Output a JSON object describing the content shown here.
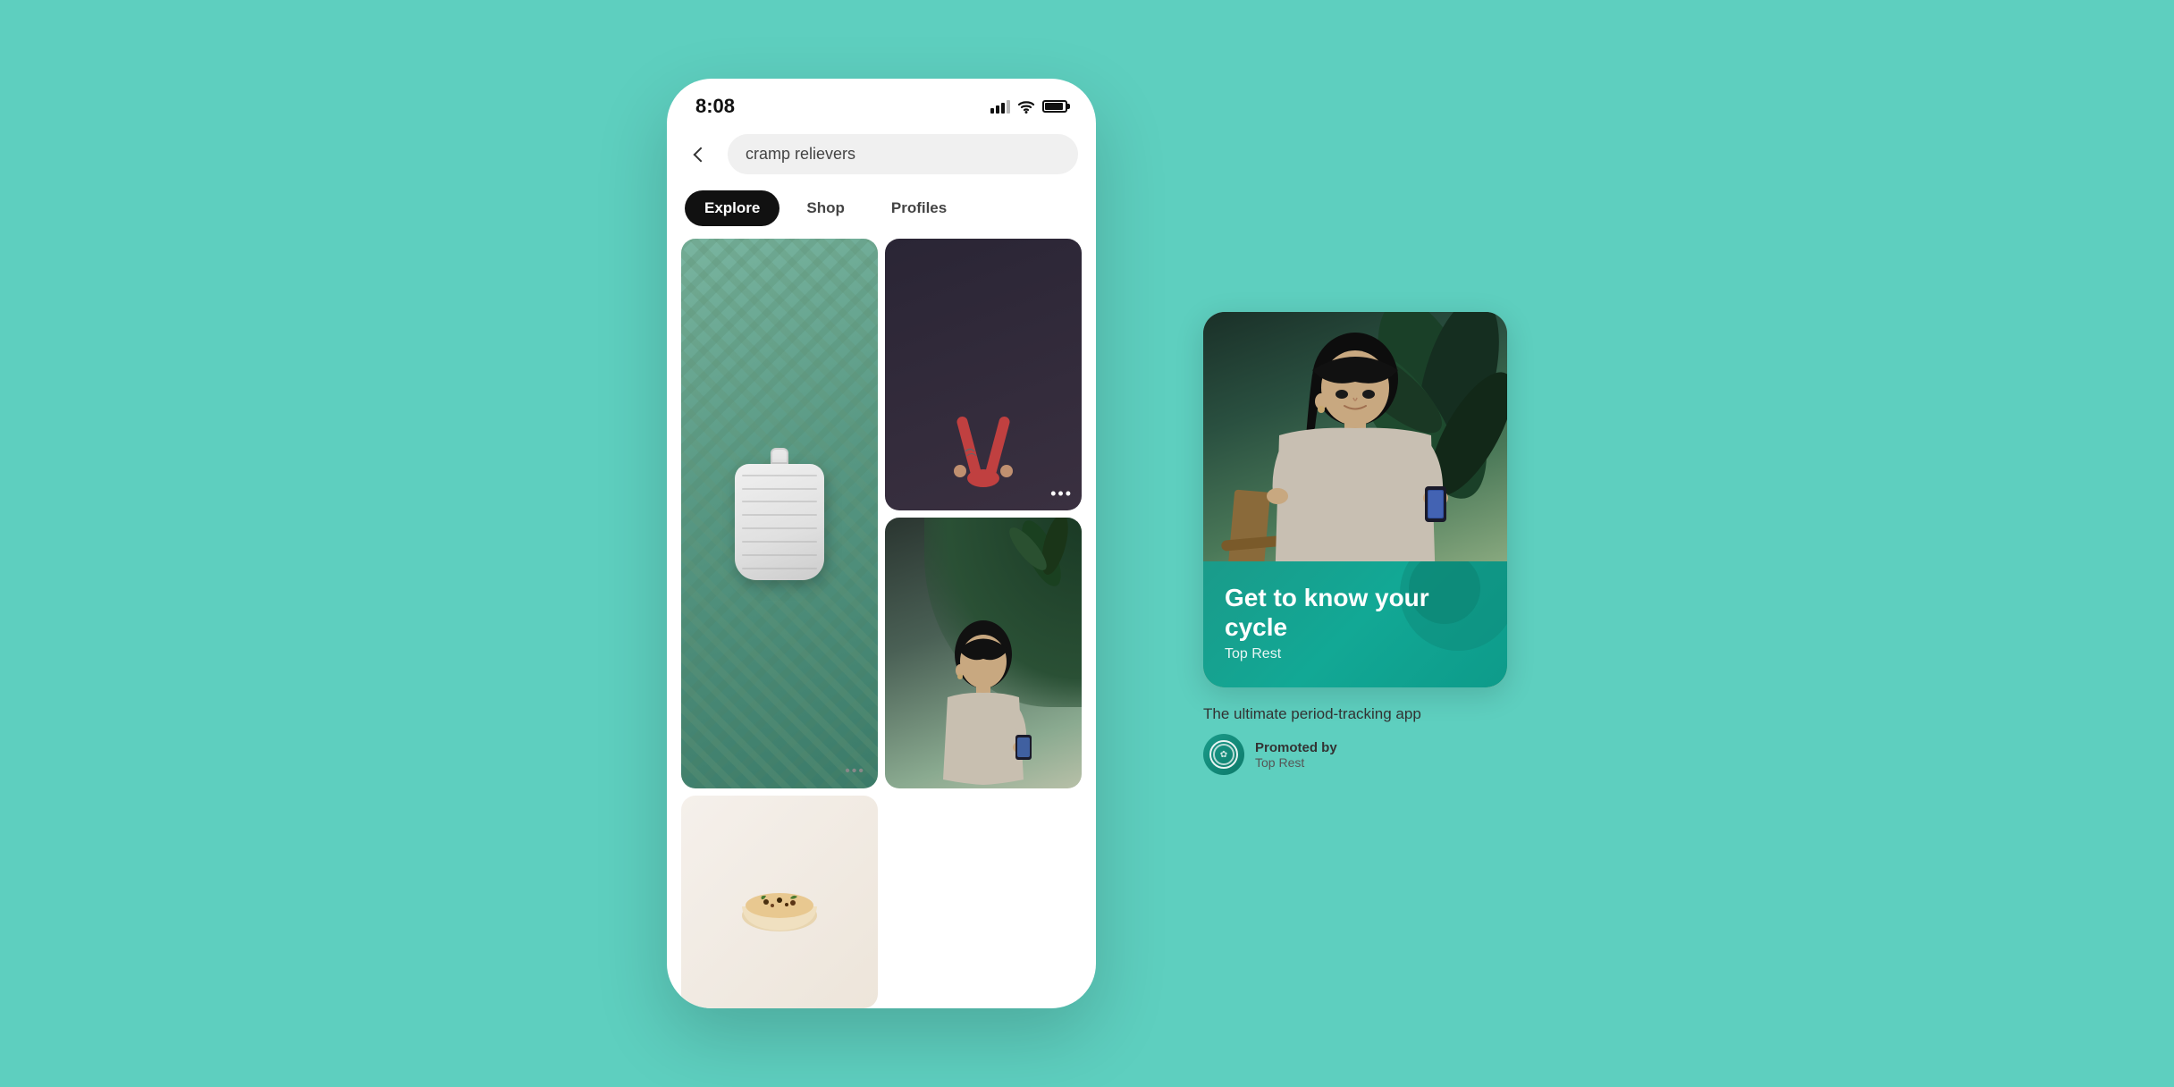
{
  "background": {
    "color": "#5ecfbf"
  },
  "phone": {
    "status": {
      "time": "8:08"
    },
    "search": {
      "query": "cramp relievers",
      "back_label": "back"
    },
    "tabs": [
      {
        "label": "Explore",
        "active": true
      },
      {
        "label": "Shop",
        "active": false
      },
      {
        "label": "Profiles",
        "active": false
      }
    ],
    "grid_items": [
      {
        "type": "hot_water_bottle",
        "tall": true
      },
      {
        "type": "yoga_pose"
      },
      {
        "type": "woman_phone"
      },
      {
        "type": "food_bowl"
      }
    ]
  },
  "ad_card": {
    "image_alt": "Woman sitting outdoors looking at phone",
    "banner": {
      "title": "Get to know\nyour cycle",
      "subtitle": "Top Rest"
    },
    "description": "The ultimate period-tracking app",
    "promoted_by": {
      "label": "Promoted by",
      "name": "Top Rest"
    }
  }
}
